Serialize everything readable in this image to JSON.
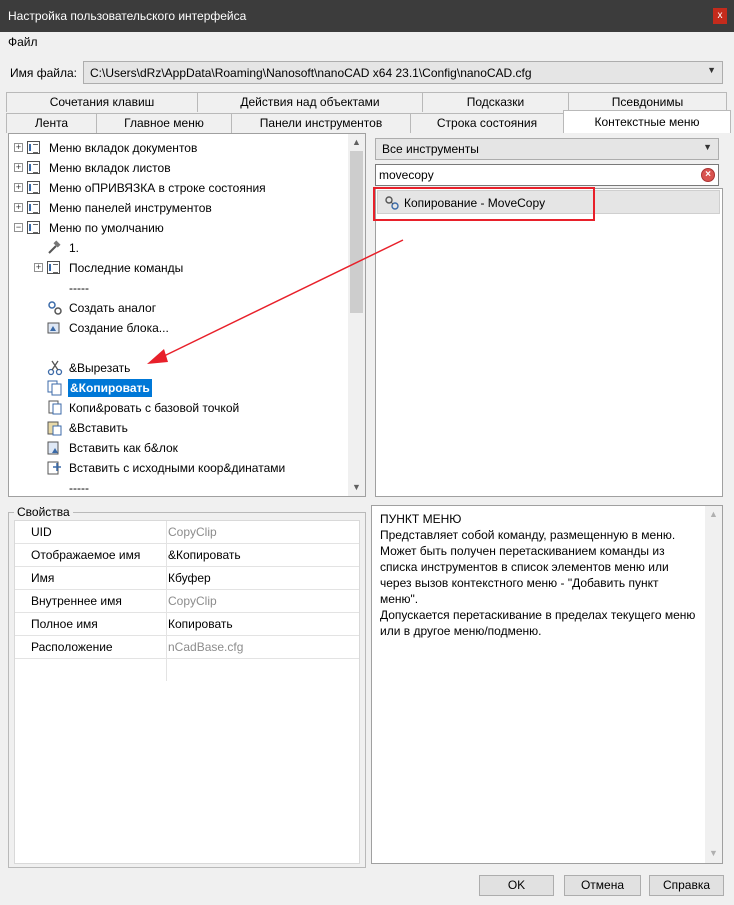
{
  "window": {
    "title": "Настройка пользовательского интерфейса",
    "close_label": "x"
  },
  "menu": {
    "file": "Файл"
  },
  "file_field": {
    "label": "Имя файла:",
    "value": "C:\\Users\\dRz\\AppData\\Roaming\\Nanosoft\\nanoCAD x64 23.1\\Config\\nanoCAD.cfg"
  },
  "tabs_row1": [
    "Сочетания клавиш",
    "Действия над объектами",
    "Подсказки",
    "Псевдонимы"
  ],
  "tabs_row2": [
    "Лента",
    "Главное меню",
    "Панели инструментов",
    "Строка состояния",
    "Контекстные меню"
  ],
  "tree": {
    "items": [
      "Меню вкладок документов",
      "Меню вкладок листов",
      "Меню оПРИВЯЗКА в строке состояния",
      "Меню панелей инструментов",
      "Меню по умолчанию",
      "1.",
      "Последние команды",
      "-----",
      "Создать аналог",
      "Создание блока...",
      "&Вырезать",
      "&Копировать",
      "Копи&ровать с базовой точкой",
      "&Вставить",
      "Вставить как б&лок",
      "Вставить с исходными коор&динатами",
      "-----"
    ]
  },
  "tools": {
    "filter_value": "Все инструменты",
    "search_value": "movecopy",
    "result": "Копирование - MoveCopy"
  },
  "properties": {
    "title": "Свойства",
    "rows": [
      {
        "key": "UID",
        "value": "CopyClip"
      },
      {
        "key": "Отображаемое имя",
        "value": "&Копировать"
      },
      {
        "key": "Имя",
        "value": "Кбуфер"
      },
      {
        "key": "Внутреннее имя",
        "value": "CopyClip"
      },
      {
        "key": "Полное имя",
        "value": "Копировать"
      },
      {
        "key": "Расположение",
        "value": "nCadBase.cfg"
      }
    ]
  },
  "description": {
    "heading": "ПУНКТ МЕНЮ",
    "lines": [
      "Представляет собой команду, размещенную в меню.",
      "Может быть получен перетаскиванием команды из",
      "списка инструментов в список элементов меню или",
      "через вызов контекстного меню - \"Добавить пункт",
      "меню\".",
      "Допускается перетаскивание в пределах текущего меню",
      "или в другое меню/подменю."
    ]
  },
  "buttons": {
    "ok": "OK",
    "cancel": "Отмена",
    "help": "Справка"
  },
  "colors": {
    "selection": "#0078d7",
    "annotation": "#e8202a",
    "titlebar": "#3c3c3c"
  }
}
